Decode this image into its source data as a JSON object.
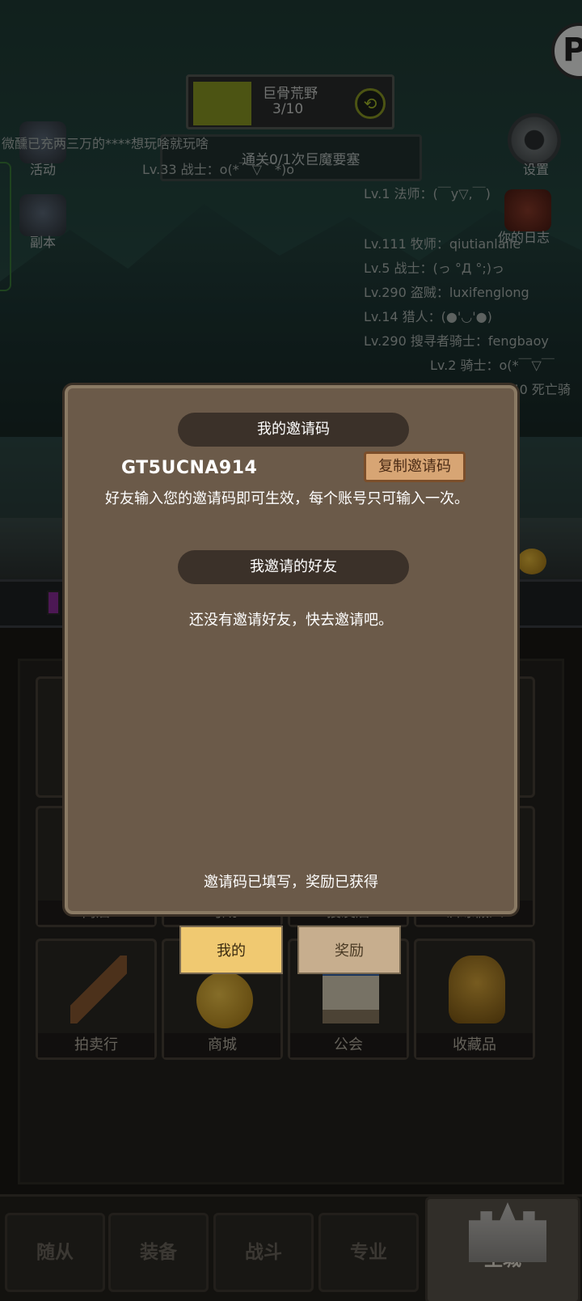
{
  "stage": {
    "name": "巨骨荒野",
    "progress": "3/10"
  },
  "quest": {
    "text": "通关0/1次巨魔要塞"
  },
  "chat": [
    "微醺已充两三万的****想玩啥就玩啥",
    "Lv.33 战士：o(*￣▽￣*)o",
    "Lv.1 法师：(￣y▽,￣)",
    "Lv.111 牧师：qiutianlaile",
    "Lv.5 战士：(っ °Д °;)っ",
    "Lv.290 盗贼：luxifenglong",
    "Lv.14 猎人：(●'◡'●)",
    "Lv.290 搜寻者骑士：fengbaoy",
    "Lv.2 骑士：o(*￣▽￣",
    "Lv.140 死亡骑"
  ],
  "side_icons": {
    "activity": "活动",
    "dungeon": "副本",
    "settings": "设置",
    "log": "你的日志"
  },
  "dialog": {
    "header_code": "我的邀请码",
    "invite_code": "GT5UCNA914",
    "copy_button": "复制邀请码",
    "description": "好友输入您的邀请码即可生效，每个账号只可输入一次。",
    "header_friends": "我邀请的好友",
    "empty_text": "还没有邀请好友，快去邀请吧。",
    "status_text": "邀请码已填写，奖励已获得"
  },
  "dialog_tabs": {
    "mine": "我的",
    "reward": "奖励"
  },
  "menu_tiles": {
    "row2": [
      "商店",
      "马厩",
      "搜友店",
      "训练假人"
    ],
    "row3": [
      "拍卖行",
      "商城",
      "公会",
      "收藏品"
    ]
  },
  "bottom_nav": [
    "随从",
    "装备",
    "战斗",
    "专业",
    "主城"
  ],
  "colors": {
    "dialog_bg": "#6b5a49",
    "header_pill": "#3b3129",
    "active_tab": "#f0c971",
    "inactive_tab": "#c7ae8e",
    "copy_button": "#d7a574"
  }
}
